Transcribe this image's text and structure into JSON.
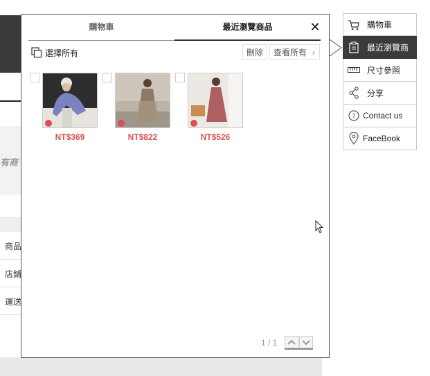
{
  "background": {
    "hint_text": "有商",
    "rows": [
      "商品",
      "店鋪",
      "運送"
    ]
  },
  "panel": {
    "tabs": [
      {
        "label": "購物車",
        "active": false
      },
      {
        "label": "最近瀏覽商品",
        "active": true
      }
    ],
    "select_all_label": "選擇所有",
    "delete_label": "刪除",
    "view_all_label": "查看所有",
    "items": [
      {
        "price": "NT$369"
      },
      {
        "price": "NT$822"
      },
      {
        "price": "NT$526"
      }
    ],
    "pagination": "1 / 1"
  },
  "sidebar": {
    "items": [
      {
        "label": "購物車",
        "icon": "cart-icon"
      },
      {
        "label": "最近瀏覽商",
        "icon": "clipboard-icon",
        "active": true
      },
      {
        "label": "尺寸參照",
        "icon": "ruler-icon"
      },
      {
        "label": "分享",
        "icon": "share-icon"
      },
      {
        "label": "Contact us",
        "icon": "question-icon"
      },
      {
        "label": "FaceBook",
        "icon": "location-pin-icon"
      }
    ]
  },
  "colors": {
    "price": "#d9534f",
    "active_sidebar_bg": "#3b3b3b"
  }
}
